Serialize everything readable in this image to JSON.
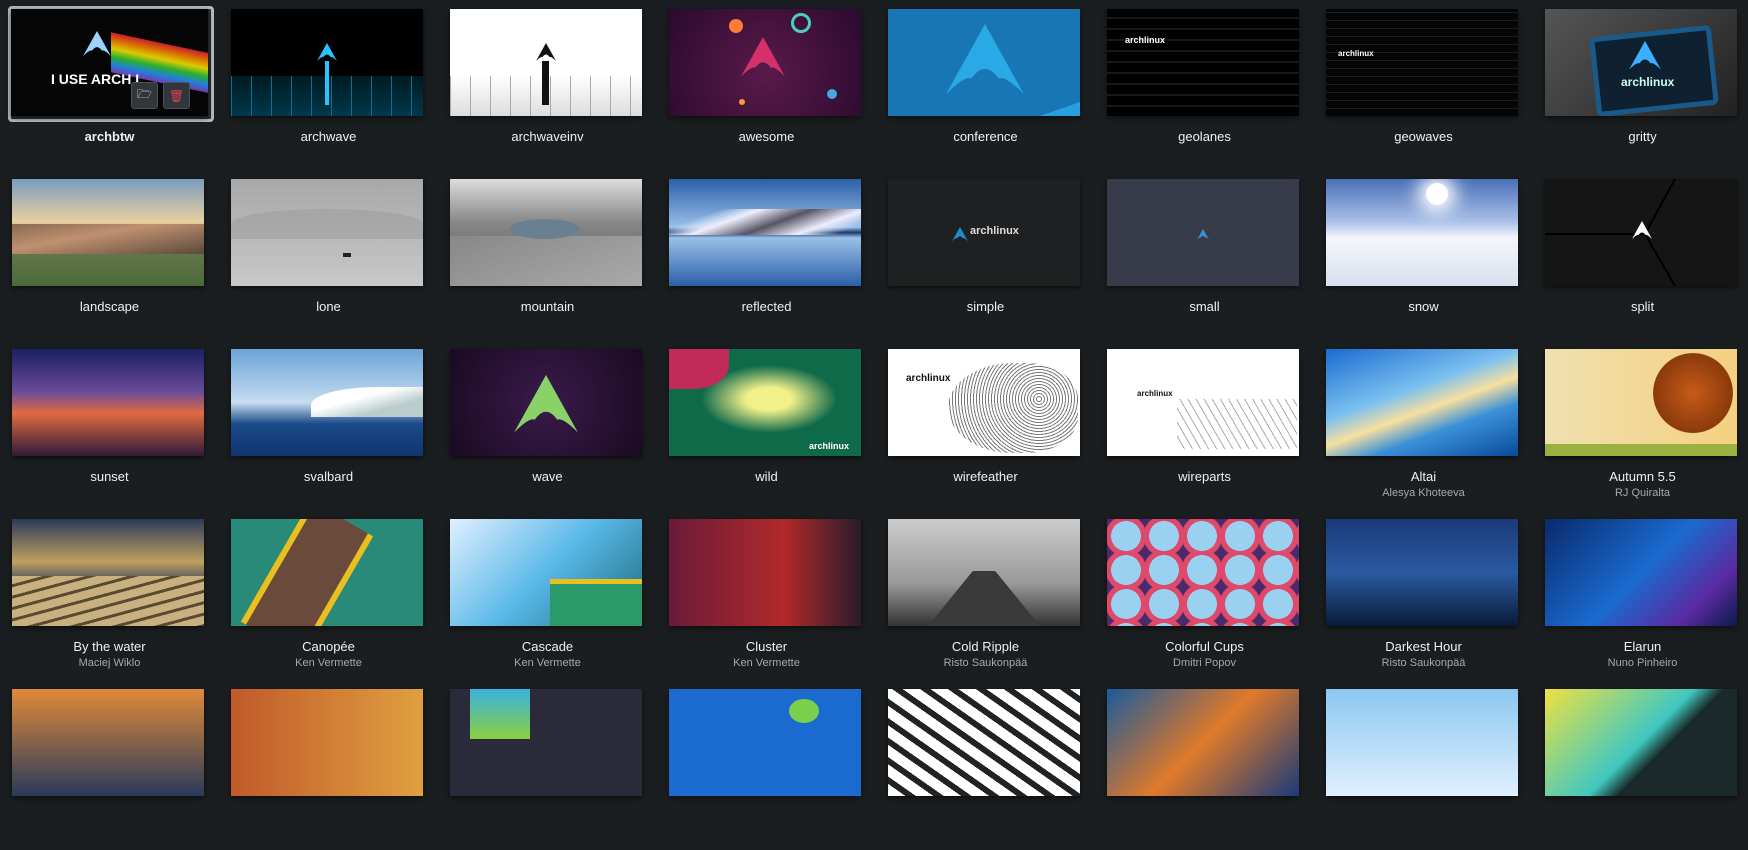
{
  "wallpapers": [
    {
      "name": "archbtw",
      "author": "",
      "selected": true,
      "overlay_text": "I USE ARCH I"
    },
    {
      "name": "archwave",
      "author": ""
    },
    {
      "name": "archwaveinv",
      "author": ""
    },
    {
      "name": "awesome",
      "author": ""
    },
    {
      "name": "conference",
      "author": ""
    },
    {
      "name": "geolanes",
      "author": ""
    },
    {
      "name": "geowaves",
      "author": ""
    },
    {
      "name": "gritty",
      "author": ""
    },
    {
      "name": "landscape",
      "author": ""
    },
    {
      "name": "lone",
      "author": ""
    },
    {
      "name": "mountain",
      "author": ""
    },
    {
      "name": "reflected",
      "author": ""
    },
    {
      "name": "simple",
      "author": ""
    },
    {
      "name": "small",
      "author": ""
    },
    {
      "name": "snow",
      "author": ""
    },
    {
      "name": "split",
      "author": ""
    },
    {
      "name": "sunset",
      "author": ""
    },
    {
      "name": "svalbard",
      "author": ""
    },
    {
      "name": "wave",
      "author": ""
    },
    {
      "name": "wild",
      "author": ""
    },
    {
      "name": "wirefeather",
      "author": ""
    },
    {
      "name": "wireparts",
      "author": ""
    },
    {
      "name": "Altai",
      "author": "Alesya Khoteeva"
    },
    {
      "name": "Autumn 5.5",
      "author": "RJ Quiralta"
    },
    {
      "name": "By the water",
      "author": "Maciej Wiklo"
    },
    {
      "name": "Canopée",
      "author": "Ken Vermette"
    },
    {
      "name": "Cascade",
      "author": "Ken Vermette"
    },
    {
      "name": "Cluster",
      "author": "Ken Vermette"
    },
    {
      "name": "Cold Ripple",
      "author": "Risto Saukonpää"
    },
    {
      "name": "Colorful Cups",
      "author": "Dmitri Popov"
    },
    {
      "name": "Darkest Hour",
      "author": "Risto Saukonpää"
    },
    {
      "name": "Elarun",
      "author": "Nuno Pinheiro"
    },
    {
      "name": "",
      "author": ""
    },
    {
      "name": "",
      "author": ""
    },
    {
      "name": "",
      "author": ""
    },
    {
      "name": "",
      "author": ""
    },
    {
      "name": "",
      "author": ""
    },
    {
      "name": "",
      "author": ""
    },
    {
      "name": "",
      "author": ""
    },
    {
      "name": "",
      "author": ""
    }
  ],
  "logo_text": "archlinux",
  "colors": {
    "background": "#1b1e20",
    "label": "#eff0f1",
    "author": "#a5a9ad",
    "delete": "#da4453",
    "arch_blue": "#1793d1"
  },
  "actions": {
    "open_folder_icon": "folder-icon",
    "delete_icon": "trash-icon"
  }
}
